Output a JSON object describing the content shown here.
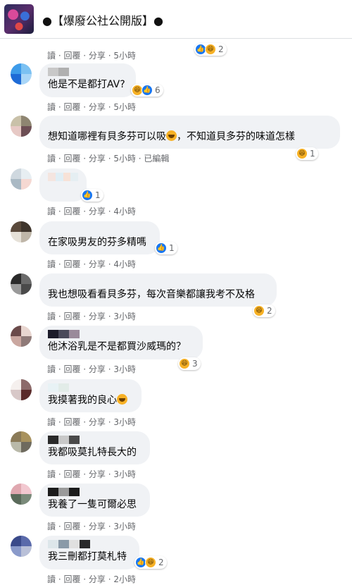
{
  "header": {
    "title": "●【爆廢公社公開版】●"
  },
  "top_reply_bar": {
    "actions": "讀 · 回覆 · 分享 · 5小時",
    "reaction_count": "2"
  },
  "comments": [
    {
      "text": "他是不是都打AV?",
      "actions": "讀 · 回覆 · 分享 · 5小時",
      "reaction_count": "6",
      "avatar": [
        "#3d9be9",
        "#7bc1f2",
        "#1e6bd6",
        "#a9d6f7"
      ],
      "blur": [
        "#c8c8c8",
        "#b0b0b0"
      ]
    },
    {
      "text": "想知道哪裡有貝多芬可以吸",
      "text_after": "，不知道貝多芬的味道怎樣",
      "actions": "讀 · 回覆 · 分享 · 5小時 · 已編輯",
      "reaction_count": "1",
      "avatar": [
        "#c9c1a9",
        "#8e8571",
        "#e7c9c5",
        "#6d4e54"
      ],
      "blur": []
    },
    {
      "text": "",
      "actions": "讀 · 回覆 · 分享 · 4小時",
      "reaction_count": "1",
      "avatar": [
        "#cfd8df",
        "#e7eef2",
        "#aab9c4",
        "#f5d8d2"
      ],
      "blur": [
        "#f4e5e0",
        "#e0eef5",
        "#f7e2d7",
        "#e5eef2"
      ]
    },
    {
      "text": "在家吸男友的芬多精嗎",
      "actions": "讀 · 回覆 · 分享 · 4小時",
      "reaction_count": "1",
      "avatar": [
        "#5a4a3c",
        "#3f352c",
        "#e6e1d8",
        "#bfb6a8"
      ],
      "blur": []
    },
    {
      "text": "我也想吸看看貝多芬，每次音樂都讓我考不及格",
      "actions": "讀 · 回覆 · 分享 · 3小時",
      "reaction_count": "2",
      "avatar": [
        "#2a2a2a",
        "#6b6b6b",
        "#9a9a9a",
        "#4a4a4a"
      ],
      "blur": []
    },
    {
      "text": "他沐浴乳是不是都買沙威瑪的？",
      "actions": "讀 · 回覆 · 分享 · 3小時",
      "reaction_count": "3",
      "avatar": [
        "#6b4a4a",
        "#e8d6d0",
        "#caa7a0",
        "#8f7a78"
      ],
      "blur": [
        "#1c1c2a",
        "#4a4a5a",
        "#9a8a9a"
      ]
    },
    {
      "text": "我摸著我的良心",
      "actions": "讀 · 回覆 · 分享 · 3小時",
      "reaction_count": "",
      "avatar": [
        "#f5f0ee",
        "#8c6a6a",
        "#d8c8c8",
        "#5a2a2a"
      ],
      "blur": [
        "#e8f2f5",
        "#e2ece8"
      ]
    },
    {
      "text": "我都吸莫扎特長大的",
      "actions": "讀 · 回覆 · 分享 · 3小時",
      "reaction_count": "",
      "avatar": [
        "#8a7a58",
        "#a8925e",
        "#b9b9a9",
        "#6e6a5e"
      ],
      "blur": [
        "#2a2a2a",
        "#c8c8c8",
        "#4a4a4a"
      ]
    },
    {
      "text": "我養了一隻可爾必思",
      "actions": "讀 · 回覆 · 分享 · 3小時",
      "reaction_count": "",
      "avatar": [
        "#e0a8b0",
        "#f2c8d0",
        "#5a6a5a",
        "#7a8a7a"
      ],
      "blur": [
        "#1c1c1c",
        "#9a9a9a",
        "#1c1c1c"
      ]
    },
    {
      "text": "我三刪都打莫札特",
      "actions": "讀 · 回覆 · 分享 · 2小時",
      "reaction_count": "2",
      "avatar": [
        "#3a4a8a",
        "#5a6aaa",
        "#8a9aca",
        "#b9c0d8"
      ],
      "blur": [
        "#dde6ea",
        "#8a9aa8",
        "#e0e0e0",
        "#2a2a2a"
      ]
    }
  ],
  "colors": {
    "like": "#1877f2",
    "haha": "#f7b125",
    "bubble": "#f0f2f5",
    "meta": "#65676b"
  }
}
